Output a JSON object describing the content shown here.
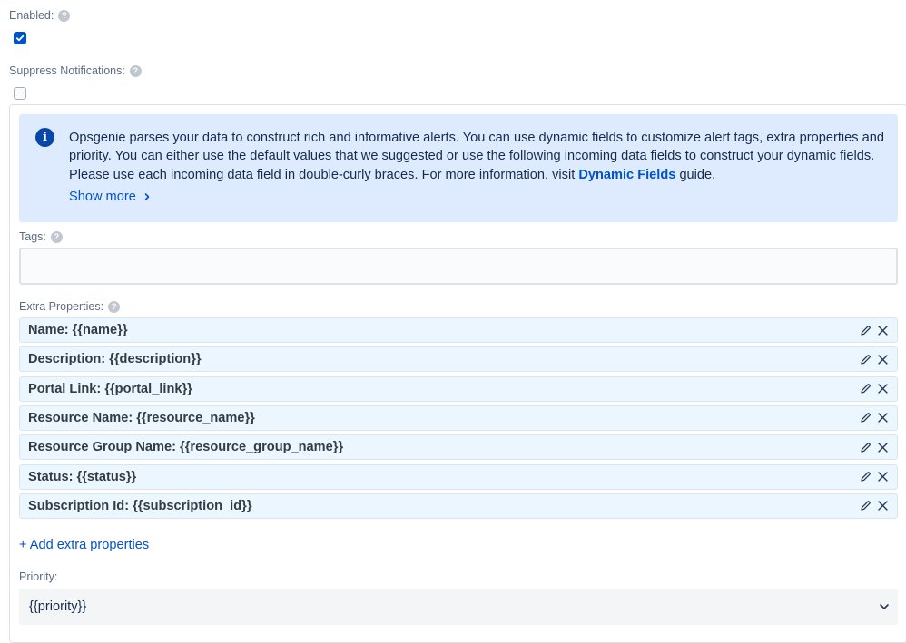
{
  "enabled": {
    "label": "Enabled:",
    "help_icon": "question-circle-icon",
    "checked": true
  },
  "suppress_notifications": {
    "label": "Suppress Notifications:",
    "help_icon": "question-circle-icon",
    "checked": false
  },
  "info_banner": {
    "icon": "info-icon",
    "text_before_link": "Opsgenie parses your data to construct rich and informative alerts. You can use dynamic fields to customize alert tags, extra properties and priority. You can either use the default values that we suggested or use the following incoming data fields to construct your dynamic fields. Please use each incoming data field in double-curly braces. For more information, visit ",
    "link_text": "Dynamic Fields",
    "text_after_link": " guide.",
    "show_more_label": "Show more",
    "show_more_icon": "chevron-right-icon"
  },
  "tags": {
    "label": "Tags:",
    "help_icon": "question-circle-icon",
    "value": ""
  },
  "extra_properties": {
    "label": "Extra Properties:",
    "help_icon": "question-circle-icon",
    "items": [
      {
        "text": "Name: {{name}}"
      },
      {
        "text": "Description: {{description}}"
      },
      {
        "text": "Portal Link: {{portal_link}}"
      },
      {
        "text": "Resource Name: {{resource_name}}"
      },
      {
        "text": "Resource Group Name: {{resource_group_name}}"
      },
      {
        "text": "Status: {{status}}"
      },
      {
        "text": "Subscription Id: {{subscription_id}}"
      }
    ],
    "edit_icon": "pencil-icon",
    "remove_icon": "close-icon",
    "add_label": "+ Add extra properties"
  },
  "priority": {
    "label": "Priority:",
    "value": "{{priority}}",
    "dropdown_icon": "chevron-down-icon"
  },
  "colors": {
    "accent": "#0052cc",
    "checkbox_checked": "#0052cc",
    "info_background": "#deebff",
    "info_icon": "#0747a6",
    "property_row_background": "#ebf6ff",
    "select_background": "#f4f5f7"
  }
}
